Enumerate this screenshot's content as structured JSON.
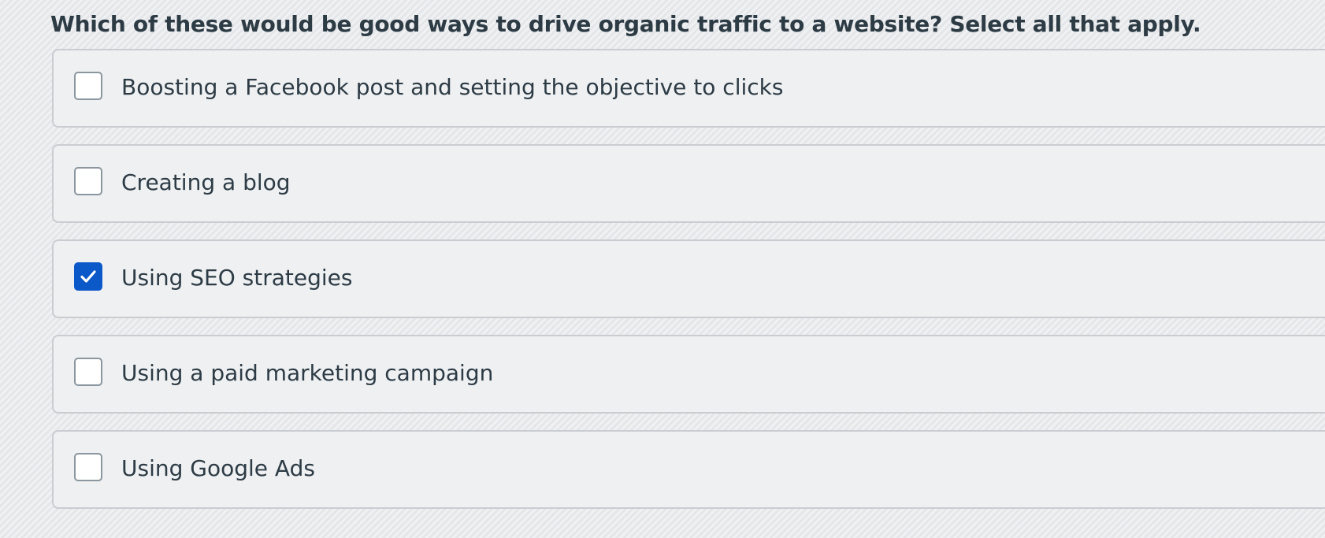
{
  "question": {
    "text": "Which of these would be good ways to drive organic traffic to a website? Select all that apply."
  },
  "options": [
    {
      "label": "Boosting a Facebook post and setting the objective to clicks",
      "checked": false
    },
    {
      "label": "Creating a blog",
      "checked": false
    },
    {
      "label": "Using SEO strategies",
      "checked": true
    },
    {
      "label": "Using a paid marketing campaign",
      "checked": false
    },
    {
      "label": "Using Google Ads",
      "checked": false
    }
  ],
  "colors": {
    "checkbox_checked": "#0b58c9",
    "text": "#2d3b45",
    "border": "#c9cdd2"
  },
  "icons": {
    "check": "checkmark-icon"
  }
}
